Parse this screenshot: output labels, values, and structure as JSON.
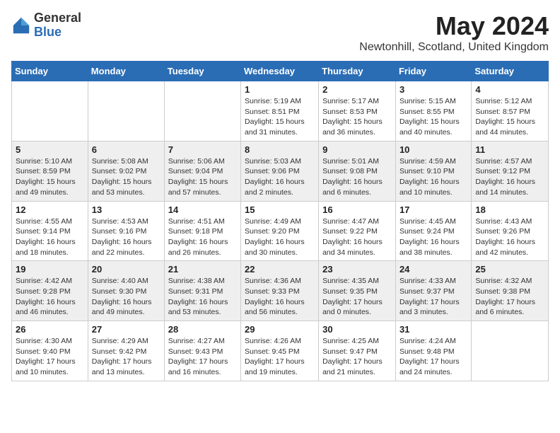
{
  "logo": {
    "general": "General",
    "blue": "Blue"
  },
  "title": {
    "month_year": "May 2024",
    "location": "Newtonhill, Scotland, United Kingdom"
  },
  "weekdays": [
    "Sunday",
    "Monday",
    "Tuesday",
    "Wednesday",
    "Thursday",
    "Friday",
    "Saturday"
  ],
  "weeks": [
    [
      {
        "day": "",
        "info": ""
      },
      {
        "day": "",
        "info": ""
      },
      {
        "day": "",
        "info": ""
      },
      {
        "day": "1",
        "info": "Sunrise: 5:19 AM\nSunset: 8:51 PM\nDaylight: 15 hours and 31 minutes."
      },
      {
        "day": "2",
        "info": "Sunrise: 5:17 AM\nSunset: 8:53 PM\nDaylight: 15 hours and 36 minutes."
      },
      {
        "day": "3",
        "info": "Sunrise: 5:15 AM\nSunset: 8:55 PM\nDaylight: 15 hours and 40 minutes."
      },
      {
        "day": "4",
        "info": "Sunrise: 5:12 AM\nSunset: 8:57 PM\nDaylight: 15 hours and 44 minutes."
      }
    ],
    [
      {
        "day": "5",
        "info": "Sunrise: 5:10 AM\nSunset: 8:59 PM\nDaylight: 15 hours and 49 minutes."
      },
      {
        "day": "6",
        "info": "Sunrise: 5:08 AM\nSunset: 9:02 PM\nDaylight: 15 hours and 53 minutes."
      },
      {
        "day": "7",
        "info": "Sunrise: 5:06 AM\nSunset: 9:04 PM\nDaylight: 15 hours and 57 minutes."
      },
      {
        "day": "8",
        "info": "Sunrise: 5:03 AM\nSunset: 9:06 PM\nDaylight: 16 hours and 2 minutes."
      },
      {
        "day": "9",
        "info": "Sunrise: 5:01 AM\nSunset: 9:08 PM\nDaylight: 16 hours and 6 minutes."
      },
      {
        "day": "10",
        "info": "Sunrise: 4:59 AM\nSunset: 9:10 PM\nDaylight: 16 hours and 10 minutes."
      },
      {
        "day": "11",
        "info": "Sunrise: 4:57 AM\nSunset: 9:12 PM\nDaylight: 16 hours and 14 minutes."
      }
    ],
    [
      {
        "day": "12",
        "info": "Sunrise: 4:55 AM\nSunset: 9:14 PM\nDaylight: 16 hours and 18 minutes."
      },
      {
        "day": "13",
        "info": "Sunrise: 4:53 AM\nSunset: 9:16 PM\nDaylight: 16 hours and 22 minutes."
      },
      {
        "day": "14",
        "info": "Sunrise: 4:51 AM\nSunset: 9:18 PM\nDaylight: 16 hours and 26 minutes."
      },
      {
        "day": "15",
        "info": "Sunrise: 4:49 AM\nSunset: 9:20 PM\nDaylight: 16 hours and 30 minutes."
      },
      {
        "day": "16",
        "info": "Sunrise: 4:47 AM\nSunset: 9:22 PM\nDaylight: 16 hours and 34 minutes."
      },
      {
        "day": "17",
        "info": "Sunrise: 4:45 AM\nSunset: 9:24 PM\nDaylight: 16 hours and 38 minutes."
      },
      {
        "day": "18",
        "info": "Sunrise: 4:43 AM\nSunset: 9:26 PM\nDaylight: 16 hours and 42 minutes."
      }
    ],
    [
      {
        "day": "19",
        "info": "Sunrise: 4:42 AM\nSunset: 9:28 PM\nDaylight: 16 hours and 46 minutes."
      },
      {
        "day": "20",
        "info": "Sunrise: 4:40 AM\nSunset: 9:30 PM\nDaylight: 16 hours and 49 minutes."
      },
      {
        "day": "21",
        "info": "Sunrise: 4:38 AM\nSunset: 9:31 PM\nDaylight: 16 hours and 53 minutes."
      },
      {
        "day": "22",
        "info": "Sunrise: 4:36 AM\nSunset: 9:33 PM\nDaylight: 16 hours and 56 minutes."
      },
      {
        "day": "23",
        "info": "Sunrise: 4:35 AM\nSunset: 9:35 PM\nDaylight: 17 hours and 0 minutes."
      },
      {
        "day": "24",
        "info": "Sunrise: 4:33 AM\nSunset: 9:37 PM\nDaylight: 17 hours and 3 minutes."
      },
      {
        "day": "25",
        "info": "Sunrise: 4:32 AM\nSunset: 9:38 PM\nDaylight: 17 hours and 6 minutes."
      }
    ],
    [
      {
        "day": "26",
        "info": "Sunrise: 4:30 AM\nSunset: 9:40 PM\nDaylight: 17 hours and 10 minutes."
      },
      {
        "day": "27",
        "info": "Sunrise: 4:29 AM\nSunset: 9:42 PM\nDaylight: 17 hours and 13 minutes."
      },
      {
        "day": "28",
        "info": "Sunrise: 4:27 AM\nSunset: 9:43 PM\nDaylight: 17 hours and 16 minutes."
      },
      {
        "day": "29",
        "info": "Sunrise: 4:26 AM\nSunset: 9:45 PM\nDaylight: 17 hours and 19 minutes."
      },
      {
        "day": "30",
        "info": "Sunrise: 4:25 AM\nSunset: 9:47 PM\nDaylight: 17 hours and 21 minutes."
      },
      {
        "day": "31",
        "info": "Sunrise: 4:24 AM\nSunset: 9:48 PM\nDaylight: 17 hours and 24 minutes."
      },
      {
        "day": "",
        "info": ""
      }
    ]
  ]
}
